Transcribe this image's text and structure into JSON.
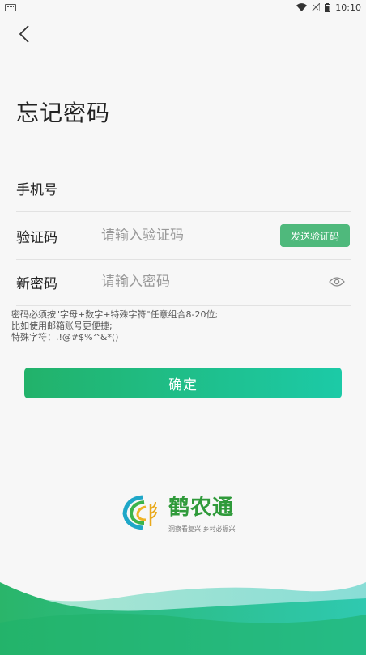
{
  "status_bar": {
    "time": "10:10"
  },
  "page": {
    "title": "忘记密码"
  },
  "form": {
    "phone_label": "手机号",
    "code_label": "验证码",
    "code_placeholder": "请输入验证码",
    "send_code_label": "发送验证码",
    "password_label": "新密码",
    "password_placeholder": "请输入密码"
  },
  "hint": {
    "line1": "密码必须按\"字母+数字+特殊字符\"任意组合8-20位;",
    "line2": "比如使用邮箱账号更便捷;",
    "line3": "特殊字符：.!@#$%^&*()"
  },
  "confirm_label": "确定",
  "logo": {
    "name": "鹤农通",
    "slogan": "洞察看复兴  乡村必振兴"
  },
  "colors": {
    "primary": "#22b26a",
    "primary_end": "#1ccaa7",
    "send_button": "#4fb97c",
    "background": "#f7f7f7"
  },
  "icons": [
    "keyboard-icon",
    "wifi-icon",
    "no-signal-icon",
    "battery-icon",
    "back-arrow-icon",
    "eye-icon",
    "logo-emblem-icon"
  ]
}
